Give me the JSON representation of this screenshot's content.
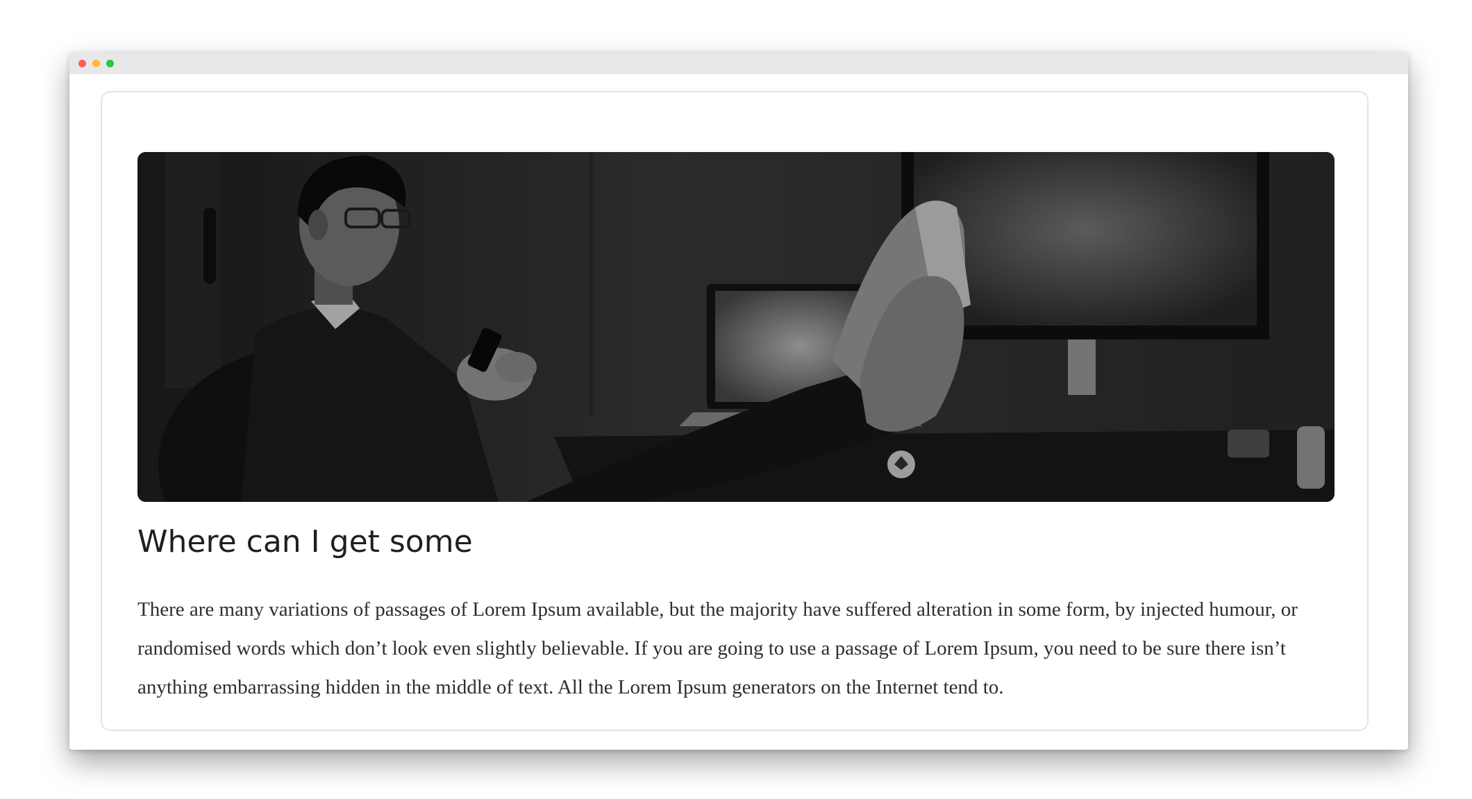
{
  "card": {
    "title": "Where can I get some",
    "text": "There are many variations of passages of Lorem Ipsum available, but the majority have suffered alteration in some form, by injected humour, or randomised words which don’t look even slightly believable. If you are going to use a passage of Lorem Ipsum, you need to be sure there isn’t anything embarrassing hidden in the middle of text. All the Lorem Ipsum generators on the Internet tend to."
  },
  "window": {
    "controls": [
      "close-icon",
      "minimize-icon",
      "maximize-icon"
    ]
  },
  "colors": {
    "close": "#fe5f57",
    "minimize": "#febc2e",
    "maximize": "#28c840",
    "title": "#1f1f1f",
    "body_text": "#2e2e2e"
  }
}
